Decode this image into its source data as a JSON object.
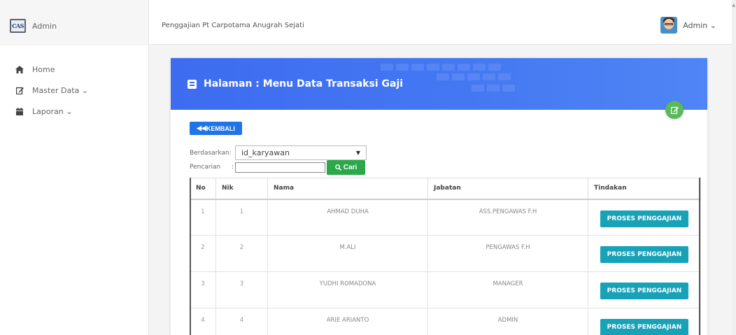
{
  "brand": {
    "logo_text": "CAS",
    "name": "Admin"
  },
  "header": {
    "title": "Penggajian Pt Carpotama Anugrah Sejati"
  },
  "user": {
    "name": "Admin",
    "caret": "⌄"
  },
  "sidebar": {
    "items": [
      {
        "label": "Home",
        "icon": "home-icon"
      },
      {
        "label": "Master Data",
        "icon": "edit-icon",
        "caret": "⌄"
      },
      {
        "label": "Laporan",
        "icon": "calendar-icon",
        "caret": "⌄"
      }
    ]
  },
  "page": {
    "title": "Halaman : Menu Data Transaksi Gaji",
    "back_label": "KEMBALI",
    "filter": {
      "by_label": "Berdasarkan:",
      "by_value": "id_karyawan",
      "search_label": "Pencarian",
      "search_sep": ":",
      "search_value": "",
      "search_button": "Cari"
    }
  },
  "table": {
    "headers": [
      "No",
      "Nik",
      "Nama",
      "Jabatan",
      "Tindakan"
    ],
    "rows": [
      {
        "no": "1",
        "nik": "1",
        "nama": "AHMAD DUHA",
        "jabatan": "ASS.PENGAWAS F.H",
        "action": "PROSES PENGGAJIAN"
      },
      {
        "no": "2",
        "nik": "2",
        "nama": "M.ALI",
        "jabatan": "PENGAWAS F.H",
        "action": "PROSES PENGGAJIAN"
      },
      {
        "no": "3",
        "nik": "3",
        "nama": "YUDHI ROMADONA",
        "jabatan": "MANAGER",
        "action": "PROSES PENGGAJIAN"
      },
      {
        "no": "4",
        "nik": "4",
        "nama": "ARIE ARIANTO",
        "jabatan": "ADMIN",
        "action": "PROSES PENGGAJIAN"
      }
    ]
  },
  "colors": {
    "header_blue": "#3d6cf0",
    "back_button": "#1e74e8",
    "search_button": "#2aa84a",
    "proses_button": "#17a2b8",
    "fab_green": "#5cb85c"
  }
}
